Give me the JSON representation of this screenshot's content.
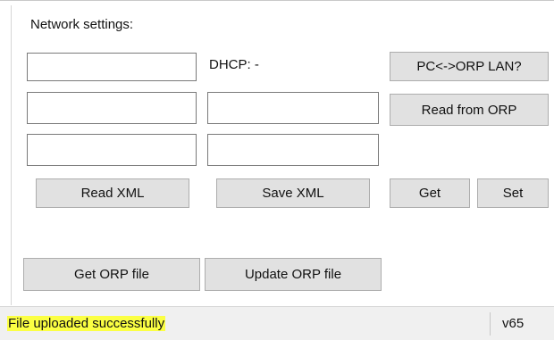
{
  "network": {
    "title": "Network settings:",
    "dhcp_label": "DHCP: -",
    "fields": {
      "row1_left": "",
      "row2_left": "",
      "row2_right": "",
      "row3_left": "",
      "row3_right": ""
    }
  },
  "buttons": {
    "pc_orp_lan": "PC<->ORP LAN?",
    "read_from_orp": "Read from ORP",
    "read_xml": "Read XML",
    "save_xml": "Save XML",
    "get": "Get",
    "set": "Set",
    "get_orp_file": "Get ORP file",
    "update_orp_file": "Update ORP file"
  },
  "status": {
    "message": "File uploaded successfully",
    "highlight_color": "#fbff43",
    "version": "v65"
  }
}
